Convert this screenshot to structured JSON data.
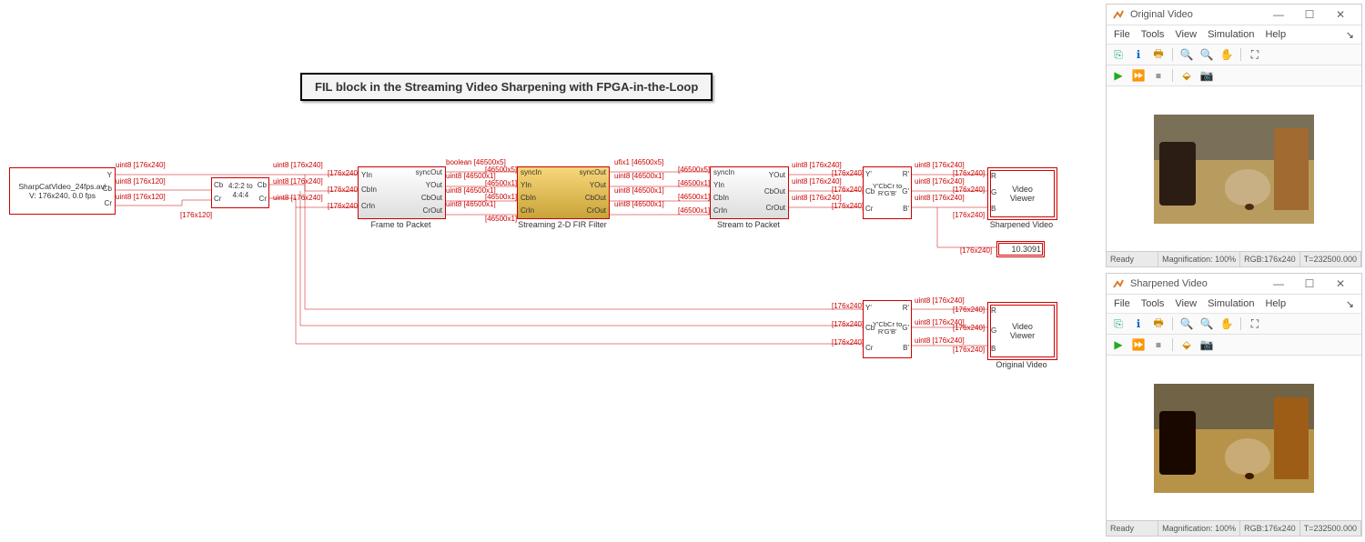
{
  "title": "FIL block in the Streaming Video Sharpening with FPGA-in-the-Loop",
  "source": {
    "file": "SharpCatVideo_24fps.avi",
    "info": "V: 176x240, 0.0 fps",
    "ports": [
      "Y",
      "Cb",
      "Cr"
    ]
  },
  "conv1": {
    "l1": "4:2:2 to",
    "l2": "4:4:4",
    "inports": [
      "Cb",
      "Cr"
    ],
    "outports": [
      "Cb",
      "Cr"
    ]
  },
  "f2p": {
    "label": "Frame to Packet",
    "inports": [
      "YIn",
      "CbIn",
      "CrIn"
    ],
    "outports": [
      "syncOut",
      "YOut",
      "CbOut",
      "CrOut"
    ]
  },
  "fir": {
    "label": "Streaming 2-D FIR  Filter",
    "inports": [
      "syncIn",
      "YIn",
      "CbIn",
      "CrIn"
    ],
    "outports": [
      "syncOut",
      "YOut",
      "CbOut",
      "CrOut"
    ]
  },
  "s2p": {
    "label": "Stream to Packet",
    "inports": [
      "syncIn",
      "YIn",
      "CbIn",
      "CrIn"
    ],
    "outports": [
      "YOut",
      "CbOut",
      "CrOut"
    ]
  },
  "ycc": {
    "label1": "Y'CbCr to",
    "label2": "R'G'B'",
    "label1_b": "Y'CbCr to",
    "label2_b": "R'G'B'",
    "inports": [
      "Y'",
      "Cb",
      "Cr"
    ],
    "outports": [
      "R'",
      "G'",
      "B'"
    ]
  },
  "vv": {
    "l1": "Video",
    "l2": "Viewer"
  },
  "vv_labels": {
    "top": "Sharpened Video",
    "bottom": "Original Video"
  },
  "display": {
    "value": "10.3091"
  },
  "sig": {
    "u8_176x240": "uint8 [176x240]",
    "u8_176x120": "uint8 [176x120]",
    "d176x240": "[176x240]",
    "d176x120": "[176x120]",
    "bool46500x5": "boolean [46500x5]",
    "u8_46500x1": "uint8 [46500x1]",
    "d46500x5": "[46500x5]",
    "d46500x1": "[46500x1]",
    "ufix1_46500x5": "ufix1 [46500x5]"
  },
  "window1": {
    "title": "Original Video",
    "ready": "Ready",
    "mag": "Magnification: 100%",
    "rgb": "RGB:176x240",
    "t": "T=232500.000"
  },
  "window2": {
    "title": "Sharpened Video",
    "ready": "Ready",
    "mag": "Magnification: 100%",
    "rgb": "RGB:176x240",
    "t": "T=232500.000"
  },
  "menus": [
    "File",
    "Tools",
    "View",
    "Simulation",
    "Help"
  ]
}
